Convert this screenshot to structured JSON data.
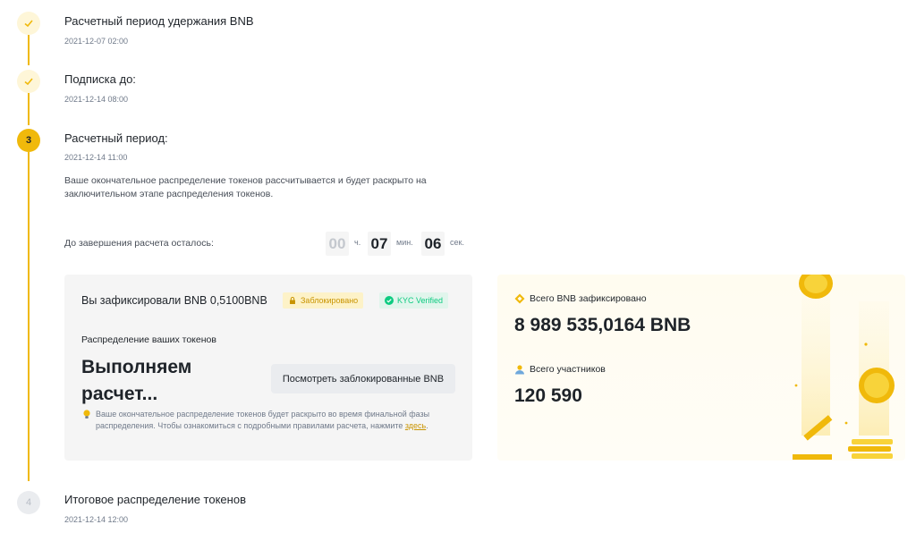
{
  "steps": [
    {
      "index": "1",
      "title": "Расчетный период удержания BNB",
      "date": "2021-12-07 02:00",
      "status": "done"
    },
    {
      "index": "2",
      "title": "Подписка до:",
      "date": "2021-12-14 08:00",
      "status": "done"
    },
    {
      "index": "3",
      "title": "Расчетный период:",
      "date": "2021-12-14 11:00",
      "status": "active"
    },
    {
      "index": "4",
      "title": "Итоговое распределение токенов",
      "date": "2021-12-14 12:00",
      "status": "pending"
    }
  ],
  "description": "Ваше окончательное распределение токенов рассчитывается и будет раскрыто на заключительном этапе распределения токенов.",
  "countdown": {
    "label": "До завершения расчета осталось:",
    "hours": "00",
    "hours_unit": "ч.",
    "minutes": "07",
    "minutes_unit": "мин.",
    "seconds": "06",
    "seconds_unit": "сек."
  },
  "locked_card": {
    "title": "Вы зафиксировали BNB 0,5100BNB",
    "locked_badge": "Заблокировано",
    "kyc_badge": "KYC Verified",
    "distribution_label": "Распределение ваших токенов",
    "status": "Выполняем расчет...",
    "view_button": "Посмотреть заблокированные BNB",
    "note_text": "Ваше окончательное распределение токенов будет раскрыто во время финальной фазы распределения. Чтобы ознакомиться с подробными правилами расчета, нажмите ",
    "note_link": "здесь",
    "note_end": "."
  },
  "stats_card": {
    "total_label": "Всего BNB зафиксировано",
    "total_value": "8 989 535,0164 BNB",
    "participants_label": "Всего участников",
    "participants_value": "120 590"
  },
  "colors": {
    "accent": "#f0b90b",
    "verified": "#0ecb81",
    "link": "#c99400"
  }
}
